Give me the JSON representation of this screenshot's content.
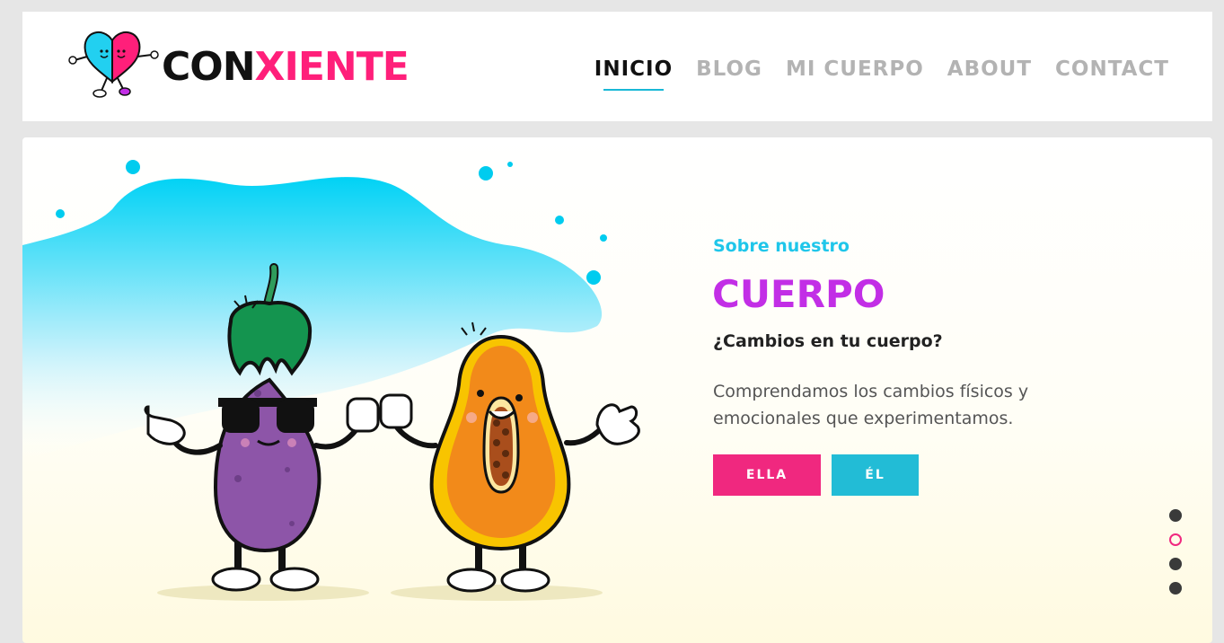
{
  "header": {
    "logo": {
      "part1": "CON",
      "part2": "XIENTE"
    },
    "nav": [
      {
        "label": "INICIO",
        "active": true
      },
      {
        "label": "BLOG",
        "active": false
      },
      {
        "label": "MI CUERPO",
        "active": false
      },
      {
        "label": "ABOUT",
        "active": false
      },
      {
        "label": "CONTACT",
        "active": false
      }
    ]
  },
  "hero": {
    "eyebrow": "Sobre nuestro",
    "title": "CUERPO",
    "subtitle": "¿Cambios en tu cuerpo?",
    "description": "Comprendamos los cambios físicos y emocionales que experimentamos.",
    "buttons": {
      "ella": "ELLA",
      "el": "ÉL"
    },
    "slider": {
      "slide_count": 4,
      "active_index": 1
    }
  },
  "colors": {
    "brand_pink": "#ff1f7a",
    "accent_cyan": "#1fc6ea",
    "title_purple": "#c22ee6",
    "button_pink": "#f0287f",
    "button_cyan": "#22bcd6"
  },
  "icons": [
    "heart-mascot-logo",
    "eggplant-character",
    "papaya-character"
  ]
}
